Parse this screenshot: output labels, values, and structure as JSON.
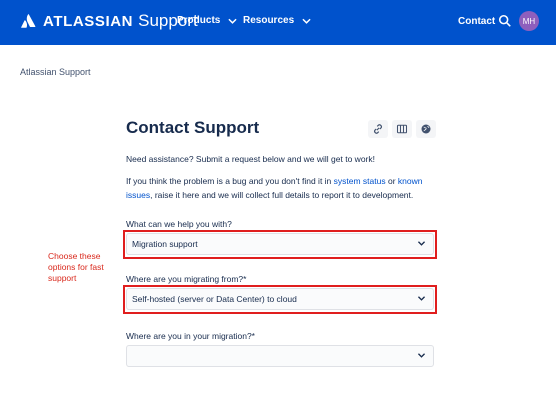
{
  "header": {
    "brand_name": "ATLASSIAN",
    "brand_sub": "Support",
    "nav_products": "Products",
    "nav_resources": "Resources",
    "nav_contact": "Contact",
    "avatar_initials": "MH",
    "brand_color": "#0052cc",
    "avatar_color": "#8e5fbd"
  },
  "breadcrumb": "Atlassian Support",
  "page": {
    "title": "Contact Support",
    "intro": "Need assistance? Submit a request below and we will get to work!",
    "bug_prefix": "If you think the problem is a bug and you don't find it in ",
    "system_status_link": "system status",
    "bug_or": " or ",
    "known_issues_link": "known issues",
    "bug_suffix": ", raise it here and we will collect full details to report it to development."
  },
  "form": {
    "q1_label": "What can we help you with?",
    "q1_value": "Migration support",
    "q2_label": "Where are you migrating from?*",
    "q2_value": "Self-hosted (server or Data Center) to cloud",
    "q3_label": "Where are you in your migration?*",
    "q3_value": ""
  },
  "annotation": "Choose these options for fast support",
  "icons": [
    "atlassian-logo-icon",
    "chevron-down-icon",
    "search-icon",
    "link-icon",
    "board-icon",
    "globe-icon"
  ],
  "colors": {
    "highlight": "#e01e1e",
    "annotation": "#d9281c",
    "link": "#0052cc"
  }
}
